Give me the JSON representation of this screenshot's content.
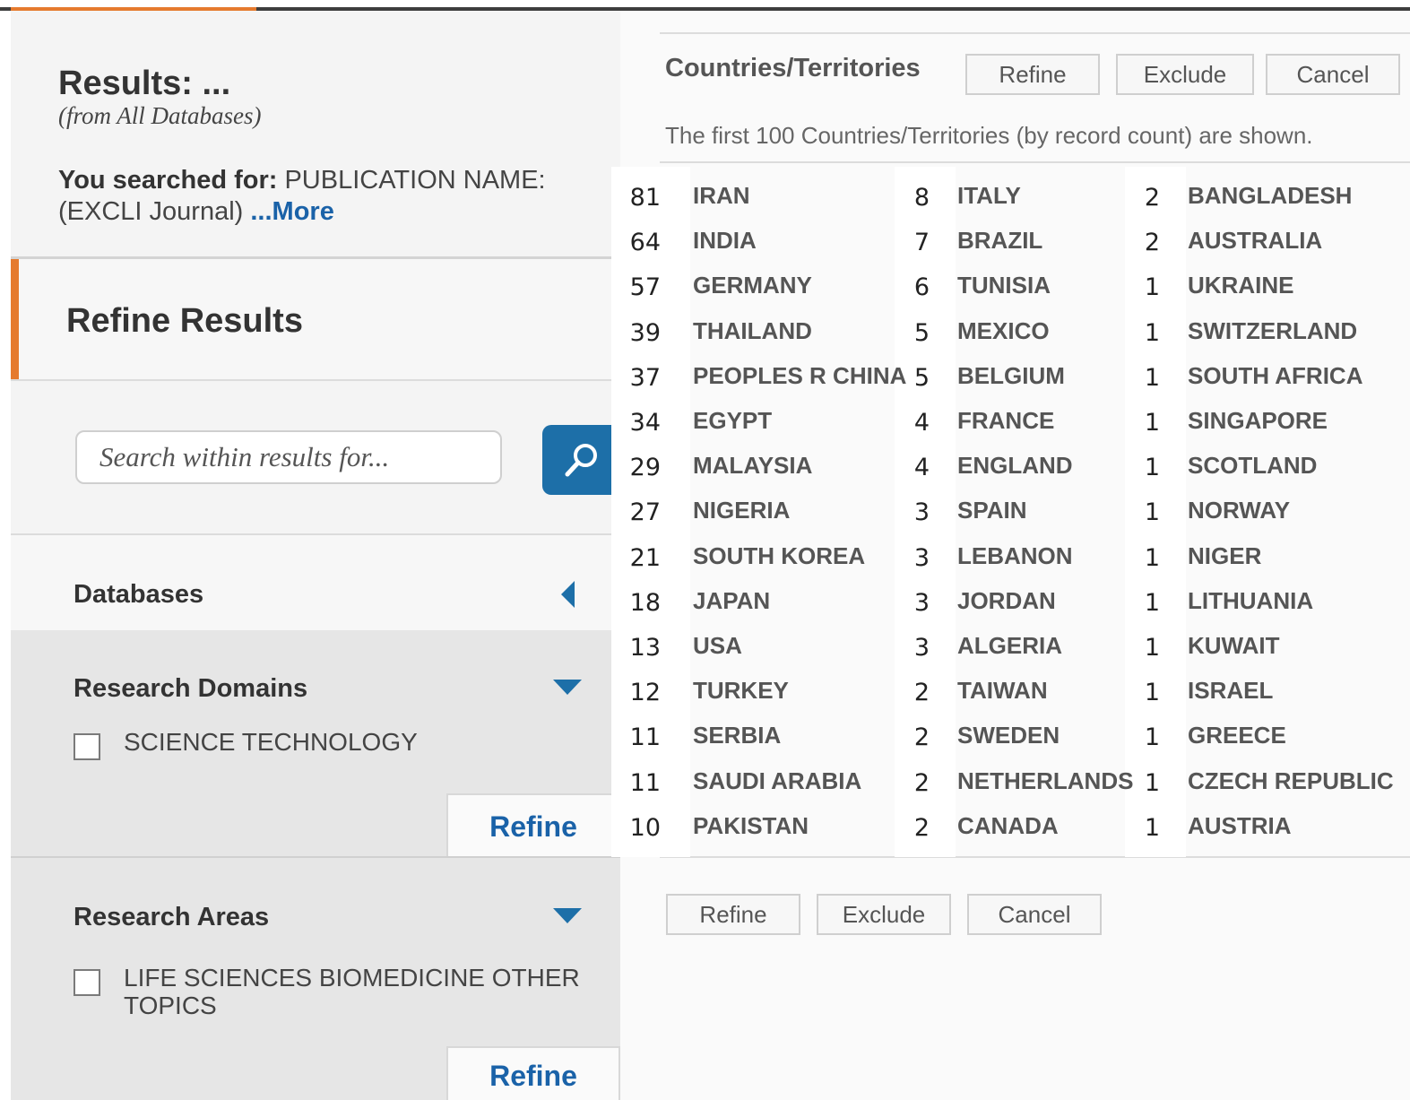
{
  "left_panel": {
    "results_title": "Results: ...",
    "results_sub": "(from All Databases)",
    "searched_label": "You searched for:",
    "searched_value": "PUBLICATION NAME: (EXCLI Journal)",
    "more_link": "...More",
    "refine_title": "Refine Results",
    "search_placeholder": "Search within results for...",
    "databases": {
      "title": "Databases",
      "state": "collapsed"
    },
    "research_domains": {
      "title": "Research Domains",
      "option": "SCIENCE TECHNOLOGY",
      "refine_label": "Refine"
    },
    "research_areas": {
      "title": "Research Areas",
      "option": "LIFE SCIENCES BIOMEDICINE OTHER TOPICS",
      "refine_label": "Refine"
    }
  },
  "right_panel": {
    "title": "Countries/Territories",
    "buttons": {
      "refine": "Refine",
      "exclude": "Exclude",
      "cancel": "Cancel"
    },
    "note": "The first 100 Countries/Territories (by record count) are shown.",
    "columns": [
      [
        {
          "count": "81",
          "name": "IRAN"
        },
        {
          "count": "64",
          "name": "INDIA"
        },
        {
          "count": "57",
          "name": "GERMANY"
        },
        {
          "count": "39",
          "name": "THAILAND"
        },
        {
          "count": "37",
          "name": "PEOPLES R CHINA"
        },
        {
          "count": "34",
          "name": "EGYPT"
        },
        {
          "count": "29",
          "name": "MALAYSIA"
        },
        {
          "count": "27",
          "name": "NIGERIA"
        },
        {
          "count": "21",
          "name": "SOUTH KOREA"
        },
        {
          "count": "18",
          "name": "JAPAN"
        },
        {
          "count": "13",
          "name": "USA"
        },
        {
          "count": "12",
          "name": "TURKEY"
        },
        {
          "count": "11",
          "name": "SERBIA"
        },
        {
          "count": "11",
          "name": "SAUDI ARABIA"
        },
        {
          "count": "10",
          "name": "PAKISTAN"
        }
      ],
      [
        {
          "count": "8",
          "name": "ITALY"
        },
        {
          "count": "7",
          "name": "BRAZIL"
        },
        {
          "count": "6",
          "name": "TUNISIA"
        },
        {
          "count": "5",
          "name": "MEXICO"
        },
        {
          "count": "5",
          "name": "BELGIUM"
        },
        {
          "count": "4",
          "name": "FRANCE"
        },
        {
          "count": "4",
          "name": "ENGLAND"
        },
        {
          "count": "3",
          "name": "SPAIN"
        },
        {
          "count": "3",
          "name": "LEBANON"
        },
        {
          "count": "3",
          "name": "JORDAN"
        },
        {
          "count": "3",
          "name": "ALGERIA"
        },
        {
          "count": "2",
          "name": "TAIWAN"
        },
        {
          "count": "2",
          "name": "SWEDEN"
        },
        {
          "count": "2",
          "name": "NETHERLANDS"
        },
        {
          "count": "2",
          "name": "CANADA"
        }
      ],
      [
        {
          "count": "2",
          "name": "BANGLADESH"
        },
        {
          "count": "2",
          "name": "AUSTRALIA"
        },
        {
          "count": "1",
          "name": "UKRAINE"
        },
        {
          "count": "1",
          "name": "SWITZERLAND"
        },
        {
          "count": "1",
          "name": "SOUTH AFRICA"
        },
        {
          "count": "1",
          "name": "SINGAPORE"
        },
        {
          "count": "1",
          "name": "SCOTLAND"
        },
        {
          "count": "1",
          "name": "NORWAY"
        },
        {
          "count": "1",
          "name": "NIGER"
        },
        {
          "count": "1",
          "name": "LITHUANIA"
        },
        {
          "count": "1",
          "name": "KUWAIT"
        },
        {
          "count": "1",
          "name": "ISRAEL"
        },
        {
          "count": "1",
          "name": "GREECE"
        },
        {
          "count": "1",
          "name": "CZECH REPUBLIC"
        },
        {
          "count": "1",
          "name": "AUSTRIA"
        }
      ]
    ]
  },
  "colors": {
    "accent_orange": "#e57a2e",
    "link_blue": "#1a62a8",
    "button_blue": "#1d6fa8"
  }
}
